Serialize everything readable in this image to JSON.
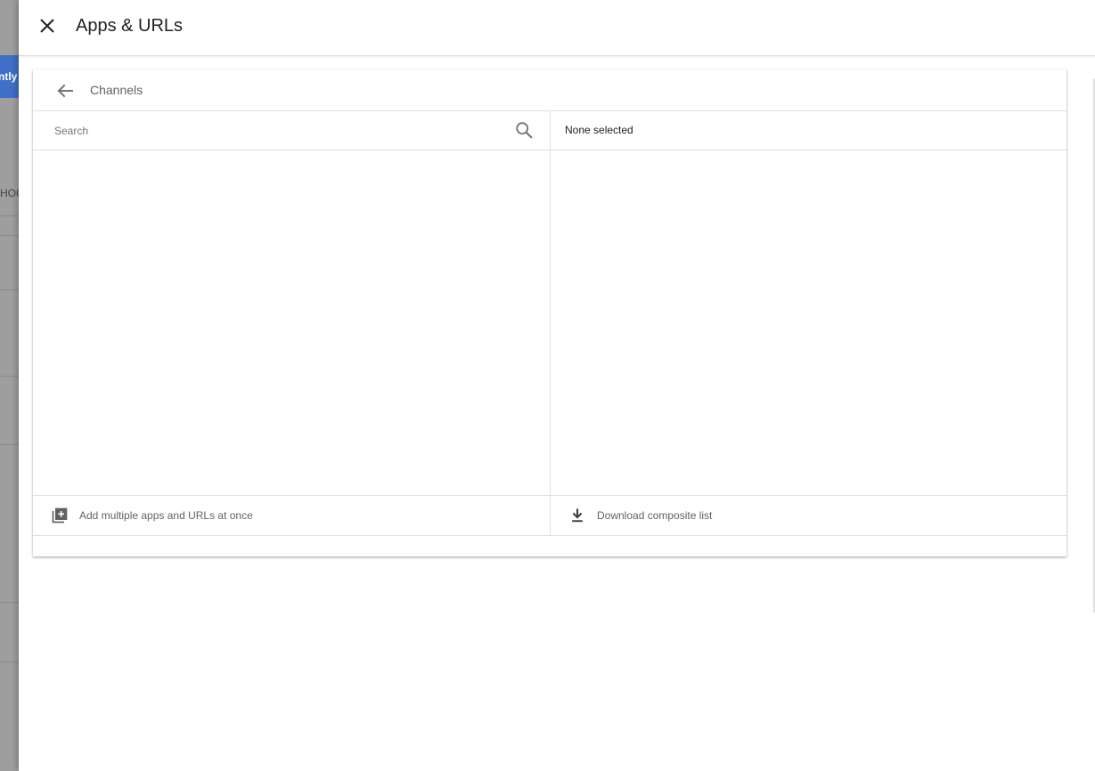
{
  "background": {
    "partial_button_text": "ntly",
    "partial_text": "HOC"
  },
  "panel": {
    "title": "Apps & URLs"
  },
  "card": {
    "title": "Channels",
    "search_placeholder": "Search",
    "selected_text": "None selected",
    "add_multiple_label": "Add multiple apps and URLs at once",
    "download_label": "Download composite list"
  },
  "icons": {
    "close": "close-icon",
    "back": "arrow-back-icon",
    "search": "search-icon",
    "add_multiple": "library-add-icon",
    "download": "download-icon"
  },
  "colors": {
    "accent_blue": "#3f6fc7",
    "text_primary": "#212121",
    "text_secondary": "#5f6368",
    "divider": "#e0e0e0"
  }
}
